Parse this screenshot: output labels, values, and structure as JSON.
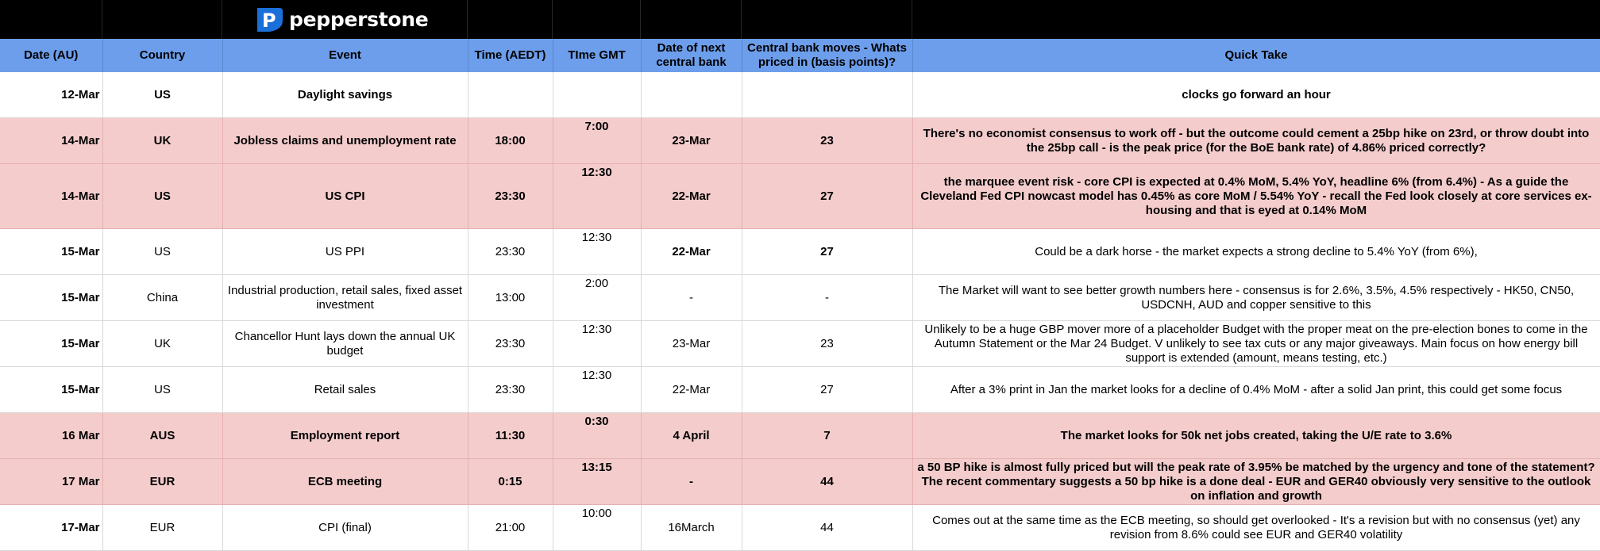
{
  "brand": {
    "name": "pepperstone",
    "logo_letter": "P"
  },
  "columns": [
    "Date (AU)",
    "Country",
    "Event",
    "Time (AEDT)",
    "TIme GMT",
    "Date of next central bank",
    "Central bank moves - Whats priced in (basis points)?",
    "Quick Take"
  ],
  "rows": [
    {
      "date": "12-Mar",
      "country": "US",
      "event": "Daylight savings",
      "aedt": "",
      "gmt": "",
      "next_cb": "",
      "priced": "",
      "take": "clocks go forward an hour"
    },
    {
      "date": "14-Mar",
      "country": "UK",
      "event": "Jobless claims and unemployment rate",
      "aedt": "18:00",
      "gmt": "7:00",
      "next_cb": "23-Mar",
      "priced": "23",
      "take": "There's no economist consensus to work off  - but the outcome could cement a 25bp hike on 23rd, or throw doubt into the 25bp call - is the peak price (for the BoE bank rate) of 4.86% priced correctly?"
    },
    {
      "date": "14-Mar",
      "country": "US",
      "event": "US CPI",
      "aedt": "23:30",
      "gmt": "12:30",
      "next_cb": "22-Mar",
      "priced": "27",
      "take": "the marquee event risk - core CPI is expected at 0.4% MoM, 5.4% YoY, headline 6% (from 6.4%) - As a guide the Cleveland Fed CPI nowcast model has 0.45% as core MoM / 5.54% YoY - recall the Fed look closely at core services ex-housing and that is eyed at 0.14% MoM"
    },
    {
      "date": "15-Mar",
      "country": "US",
      "event": "US PPI",
      "aedt": "23:30",
      "gmt": "12:30",
      "next_cb": "22-Mar",
      "priced": "27",
      "take": "Could be a dark horse - the market expects a strong decline to 5.4% YoY (from 6%),"
    },
    {
      "date": "15-Mar",
      "country": "China",
      "event": "Industrial production, retail sales, fixed asset investment",
      "aedt": "13:00",
      "gmt": "2:00",
      "next_cb": "-",
      "priced": "-",
      "take": "The Market will want to see better growth numbers here - consensus is for 2.6%, 3.5%, 4.5% respectively - HK50, CN50, USDCNH, AUD and copper sensitive to this"
    },
    {
      "date": "15-Mar",
      "country": "UK",
      "event": "Chancellor Hunt lays down the annual UK budget",
      "aedt": "23:30",
      "gmt": "12:30",
      "next_cb": "23-Mar",
      "priced": "23",
      "take": "Unlikely to be a huge GBP mover  more of a placeholder Budget with the proper meat on the pre-election bones to come in the Autumn Statement or the Mar 24 Budget. V unlikely to see tax cuts or any major giveaways. Main focus on how energy bill support is extended (amount, means testing, etc.)"
    },
    {
      "date": "15-Mar",
      "country": "US",
      "event": "Retail sales",
      "aedt": "23:30",
      "gmt": "12:30",
      "next_cb": "22-Mar",
      "priced": "27",
      "take": "After a 3% print in Jan the market looks for a decline of 0.4% MoM - after a solid Jan print, this could get some focus"
    },
    {
      "date": "16 Mar",
      "country": "AUS",
      "event": "Employment report",
      "aedt": "11:30",
      "gmt": "0:30",
      "next_cb": "4 April",
      "priced": "7",
      "take": "The market looks for 50k net jobs created, taking the U/E rate to 3.6%"
    },
    {
      "date": "17 Mar",
      "country": "EUR",
      "event": "ECB meeting",
      "aedt": "0:15",
      "gmt": "13:15",
      "next_cb": "-",
      "priced": "44",
      "take": "a 50 BP hike is almost fully priced but will the peak rate of 3.95% be matched by the urgency and tone of the statement? The recent commentary suggests a 50 bp hike is a done deal - EUR and GER40 obviously very sensitive to the outlook on inflation and growth"
    },
    {
      "date": "17-Mar",
      "country": "EUR",
      "event": "CPI (final)",
      "aedt": "21:00",
      "gmt": "10:00",
      "next_cb": "16March",
      "priced": "44",
      "take": "Comes out at the same time as the ECB meeting, so should get overlooked - It's a revision but with no consensus (yet) any revision from 8.6% could see EUR and GER40 volatility"
    }
  ]
}
